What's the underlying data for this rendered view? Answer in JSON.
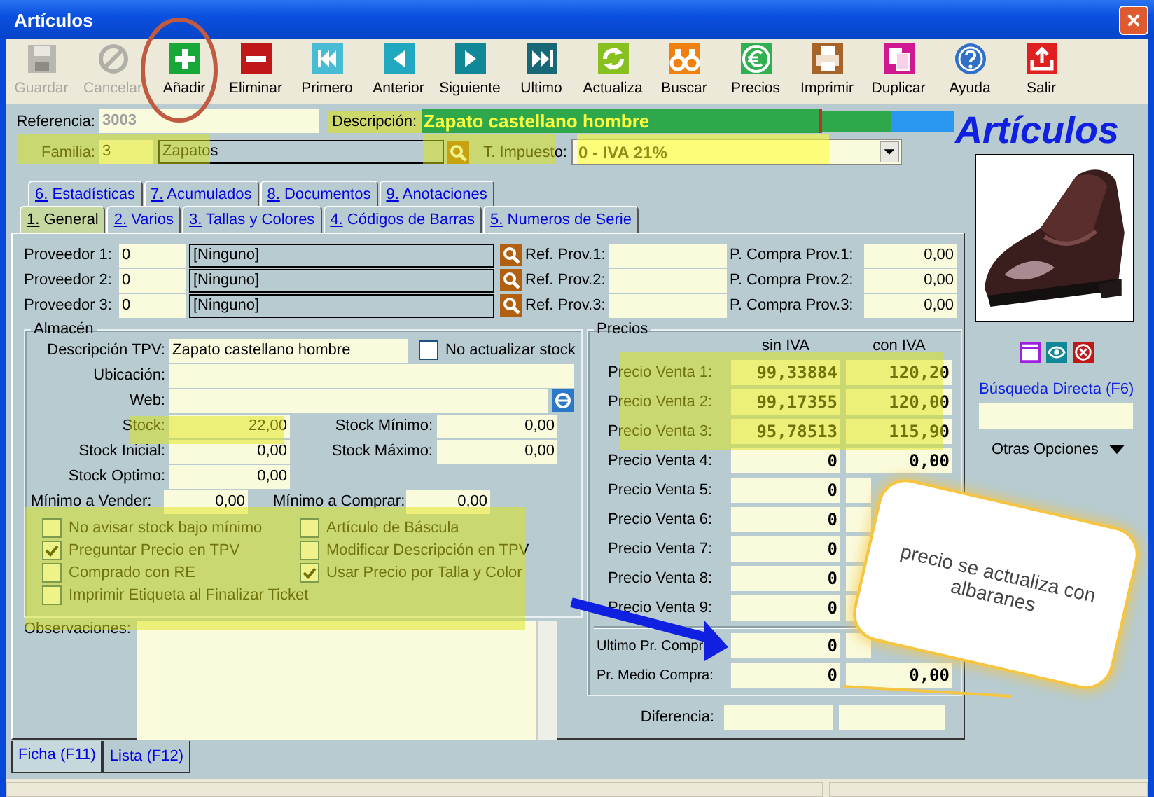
{
  "window": {
    "title": "Artículos"
  },
  "toolbar": [
    {
      "label": "Guardar",
      "disabled": true
    },
    {
      "label": "Cancelar",
      "disabled": true
    },
    {
      "label": "Añadir",
      "disabled": false
    },
    {
      "label": "Eliminar",
      "disabled": false
    },
    {
      "label": "Primero",
      "disabled": false
    },
    {
      "label": "Anterior",
      "disabled": false
    },
    {
      "label": "Siguiente",
      "disabled": false
    },
    {
      "label": "Ultimo",
      "disabled": false
    },
    {
      "label": "Actualiza",
      "disabled": false
    },
    {
      "label": "Buscar",
      "disabled": false
    },
    {
      "label": "Precios",
      "disabled": false
    },
    {
      "label": "Imprimir",
      "disabled": false
    },
    {
      "label": "Duplicar",
      "disabled": false
    },
    {
      "label": "Ayuda",
      "disabled": false
    },
    {
      "label": "Salir",
      "disabled": false
    }
  ],
  "header": {
    "referencia": {
      "label": "Referencia:",
      "value": "3003"
    },
    "descripcion": {
      "label": "Descripción:",
      "value": "Zapato castellano hombre"
    },
    "familia": {
      "label": "Familia:",
      "code": "3",
      "name": "Zapatos"
    },
    "impuesto": {
      "label": "T. Impuesto:",
      "value": "0 - IVA 21%"
    },
    "heading": "Artículos"
  },
  "tab_rows": [
    [
      {
        "label": "6. Estadísticas",
        "selected": false
      },
      {
        "label": "7. Acumulados",
        "selected": false
      },
      {
        "label": "8. Documentos",
        "selected": false
      },
      {
        "label": "9. Anotaciones",
        "selected": false
      }
    ],
    [
      {
        "label": "1. General",
        "selected": true
      },
      {
        "label": "2. Varios",
        "selected": false
      },
      {
        "label": "3. Tallas y Colores",
        "selected": false
      },
      {
        "label": "4. Códigos de Barras",
        "selected": false
      },
      {
        "label": "5. Numeros de Serie",
        "selected": false
      }
    ]
  ],
  "proveedores": [
    {
      "label": "Proveedor 1:",
      "code": "0",
      "name": "[Ninguno]",
      "ref_label": "Ref. Prov.1:",
      "price_label": "P. Compra Prov.1:",
      "price": "0,00"
    },
    {
      "label": "Proveedor 2:",
      "code": "0",
      "name": "[Ninguno]",
      "ref_label": "Ref. Prov.2:",
      "price_label": "P. Compra Prov.2:",
      "price": "0,00"
    },
    {
      "label": "Proveedor 3:",
      "code": "0",
      "name": "[Ninguno]",
      "ref_label": "Ref. Prov.3:",
      "price_label": "P. Compra Prov.3:",
      "price": "0,00"
    }
  ],
  "almacen": {
    "title": "Almacén",
    "descripcion_tpv": {
      "label": "Descripción TPV:",
      "value": "Zapato castellano hombre"
    },
    "no_actualizar": {
      "label": "No actualizar stock",
      "checked": false
    },
    "ubicacion": {
      "label": "Ubicación:"
    },
    "web": {
      "label": "Web:"
    },
    "stock_rows": [
      [
        {
          "label": "Stock:",
          "value": "22,00"
        },
        {
          "label": "Stock Mínimo:",
          "value": "0,00"
        }
      ],
      [
        {
          "label": "Stock Inicial:",
          "value": "0,00"
        },
        {
          "label": "Stock Máximo:",
          "value": "0,00"
        }
      ],
      [
        {
          "label": "Stock Optimo:",
          "value": "0,00"
        }
      ]
    ],
    "minimos": [
      {
        "label": "Mínimo a Vender:",
        "value": "0,00"
      },
      {
        "label": "Mínimo a Comprar:",
        "value": "0,00"
      }
    ],
    "options": [
      [
        {
          "label": "No avisar stock bajo mínimo",
          "checked": false
        },
        {
          "label": "Preguntar Precio en TPV",
          "checked": true
        },
        {
          "label": "Comprado con RE",
          "checked": false
        },
        {
          "label": "Imprimir Etiqueta al Finalizar Ticket",
          "checked": false
        }
      ],
      [
        {
          "label": "Artículo de Báscula",
          "checked": false
        },
        {
          "label": "Modificar Descripción en TPV",
          "checked": false
        },
        {
          "label": "Usar Precio por Talla y Color",
          "checked": true
        }
      ]
    ]
  },
  "observaciones": {
    "label": "Observaciones:"
  },
  "precios": {
    "title": "Precios",
    "columns": [
      "sin IVA",
      "con IVA"
    ],
    "rows": [
      {
        "label": "Precio Venta 1:",
        "sin": "99,33884",
        "con": "120,20"
      },
      {
        "label": "Precio Venta 2:",
        "sin": "99,17355",
        "con": "120,00"
      },
      {
        "label": "Precio Venta 3:",
        "sin": "95,78513",
        "con": "115,90"
      },
      {
        "label": "Precio Venta 4:",
        "sin": "0",
        "con": "0,00"
      },
      {
        "label": "Precio Venta 5:",
        "sin": "0"
      },
      {
        "label": "Precio Venta 6:",
        "sin": "0"
      },
      {
        "label": "Precio Venta 7:",
        "sin": "0"
      },
      {
        "label": "Precio Venta 8:",
        "sin": "0"
      },
      {
        "label": "Precio Venta 9:",
        "sin": "0"
      }
    ],
    "compra": [
      {
        "label": "Ultimo Pr. Compr",
        "sin": "0"
      },
      {
        "label": "Pr. Medio Compra:",
        "sin": "0",
        "con": "0,00"
      }
    ],
    "diferencia": {
      "label": "Diferencia:"
    }
  },
  "side": {
    "busqueda": "Búsqueda Directa (F6)",
    "otras": "Otras Opciones"
  },
  "bottom_tabs": [
    {
      "label": "Ficha (F11)",
      "selected": true
    },
    {
      "label": "Lista (F12)",
      "selected": false
    }
  ],
  "note": {
    "text": "precio se actualiza con albaranes"
  }
}
